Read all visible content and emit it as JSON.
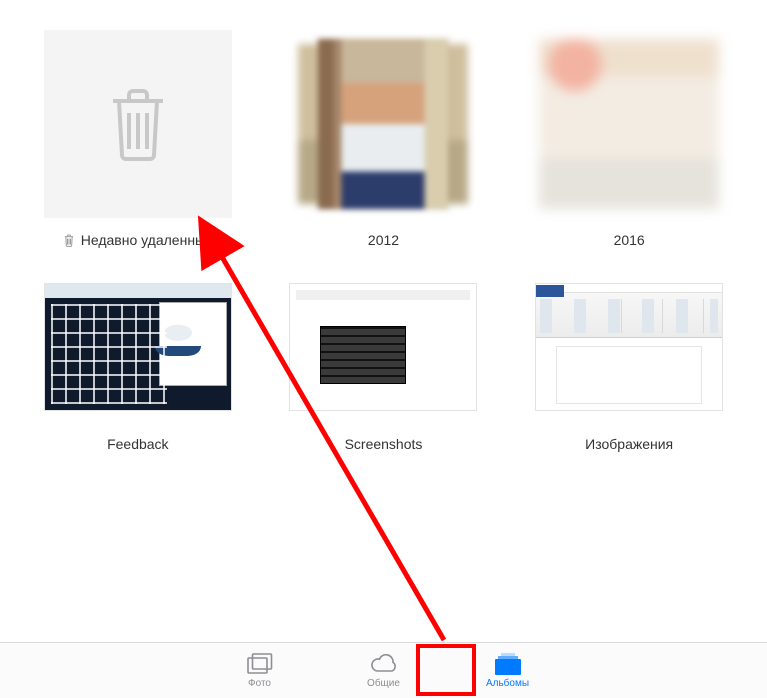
{
  "albums": [
    {
      "id": "recently-deleted",
      "label": "Недавно удаленные",
      "has_trash_prefix": true
    },
    {
      "id": "2012",
      "label": "2012"
    },
    {
      "id": "2016",
      "label": "2016"
    },
    {
      "id": "feedback",
      "label": "Feedback"
    },
    {
      "id": "screenshots",
      "label": "Screenshots"
    },
    {
      "id": "images",
      "label": "Изображения"
    }
  ],
  "tabs": {
    "photos": "Фото",
    "shared": "Общие",
    "albums": "Альбомы"
  },
  "active_tab": "albums",
  "annotation": {
    "arrow_from": "albums-tab",
    "arrow_to": "recently-deleted-album",
    "color": "#ff0000"
  }
}
